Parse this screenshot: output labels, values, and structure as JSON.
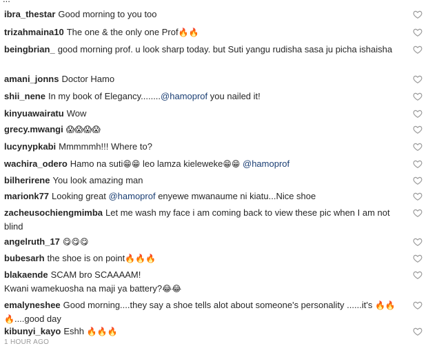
{
  "partial_top": "...",
  "comments": [
    {
      "user": "ibra_thestar",
      "parts": [
        {
          "t": "Good morning to you too"
        }
      ]
    },
    {
      "user": "trizahmaina10",
      "parts": [
        {
          "t": "The one & the only one Prof"
        },
        {
          "e": "🔥🔥"
        }
      ]
    },
    {
      "user": "beingbrian_",
      "parts": [
        {
          "t": "good morning prof. u look sharp today. but Suti yangu rudisha sasa ju picha ishaisha"
        }
      ]
    },
    {
      "user": "amani_jonns",
      "parts": [
        {
          "t": "Doctor Hamo"
        }
      ]
    },
    {
      "user": "shii_nene",
      "parts": [
        {
          "t": "In my book of Elegancy........"
        },
        {
          "m": "@hamoprof"
        },
        {
          "t": " you nailed it!"
        }
      ]
    },
    {
      "user": "kinyuawairatu",
      "parts": [
        {
          "t": "Wow"
        }
      ]
    },
    {
      "user": "grecy.mwangi",
      "parts": [
        {
          "e": "😱😱😱😱"
        }
      ]
    },
    {
      "user": "lucynypkabi",
      "parts": [
        {
          "t": "Mmmmmh!!! Where to?"
        }
      ]
    },
    {
      "user": "wachira_odero",
      "parts": [
        {
          "t": "Hamo na suti"
        },
        {
          "e": "😁😁"
        },
        {
          "t": " leo lamza kieleweke"
        },
        {
          "e": "😁😁"
        },
        {
          "t": " "
        },
        {
          "m": "@hamoprof"
        }
      ]
    },
    {
      "user": "bilherirene",
      "parts": [
        {
          "t": "You look amazing man"
        }
      ]
    },
    {
      "user": "marionk77",
      "parts": [
        {
          "t": "Looking great "
        },
        {
          "m": "@hamoprof"
        },
        {
          "t": " enyewe mwanaume ni kiatu...Nice shoe"
        }
      ]
    },
    {
      "user": "zacheusochiengmimba",
      "parts": [
        {
          "t": "Let me wash my face i am coming back to view these pic when I am not blind"
        }
      ]
    },
    {
      "user": "angelruth_17",
      "parts": [
        {
          "e": "😋😋😋"
        }
      ]
    },
    {
      "user": "bubesarh",
      "parts": [
        {
          "t": "the shoe is on point"
        },
        {
          "e": "🔥🔥🔥"
        }
      ]
    },
    {
      "user": "blakaende",
      "parts": [
        {
          "t": "SCAM bro SCAAAAM!\nKwani wamekuosha na maji ya battery?"
        },
        {
          "e": "😂😂"
        }
      ]
    },
    {
      "user": "emalyneshee",
      "parts": [
        {
          "t": "Good morning....they say a shoe tells alot about someone's personality ......it's "
        },
        {
          "e": "🔥🔥🔥"
        },
        {
          "t": "....good day"
        }
      ]
    },
    {
      "user": "kibunyi_kayo",
      "parts": [
        {
          "t": "Eshh "
        },
        {
          "e": "🔥🔥🔥"
        }
      ]
    }
  ],
  "timestamp": "1 HOUR AGO",
  "colors": {
    "text": "#262626",
    "mention": "#1a3e73",
    "icon": "#999999"
  },
  "icons": {
    "like": "heart-outline-icon"
  }
}
